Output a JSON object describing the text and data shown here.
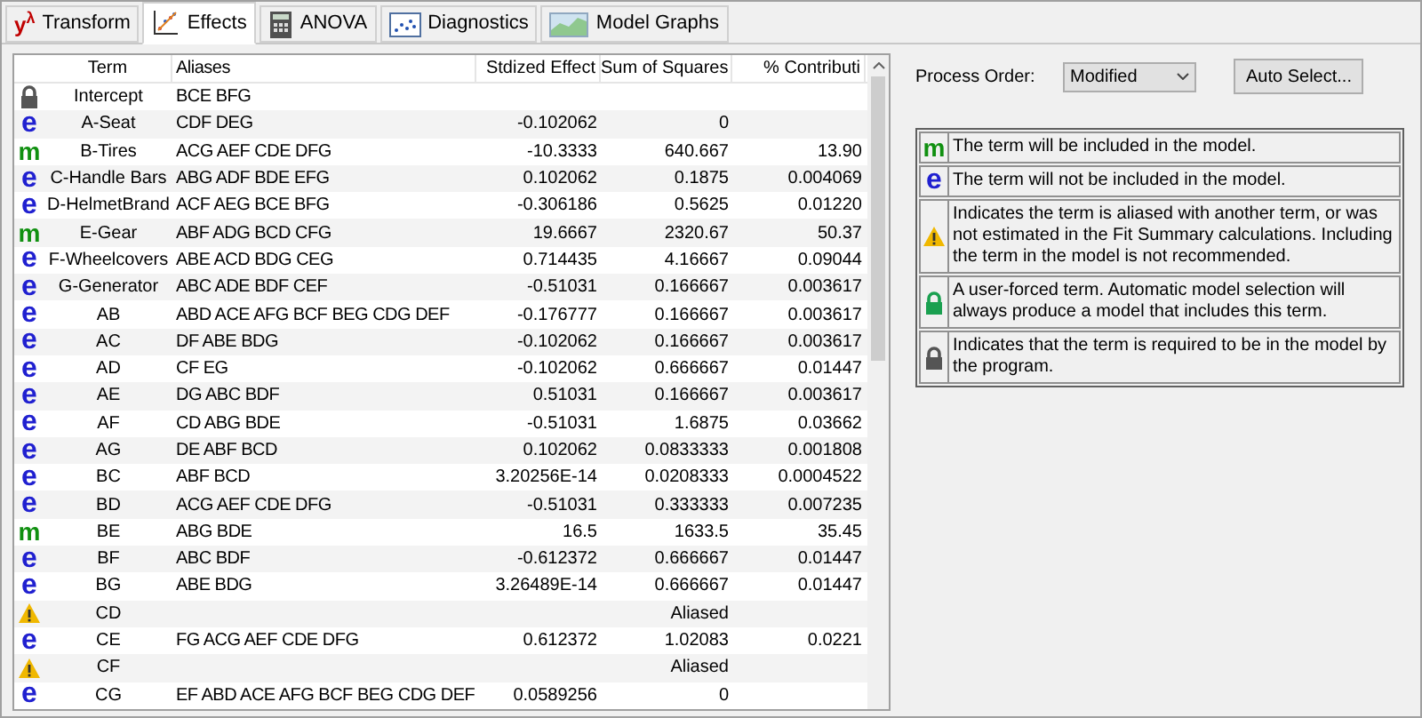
{
  "tabs": [
    {
      "label": "Transform",
      "symbol": "y$^{λ}$",
      "selected": false
    },
    {
      "label": "Effects",
      "selected": true
    },
    {
      "label": "ANOVA",
      "selected": false
    },
    {
      "label": "Diagnostics",
      "selected": false
    },
    {
      "label": "Model Graphs",
      "selected": false
    }
  ],
  "table": {
    "columns": [
      "Term",
      "Aliases",
      "Stdized Effect",
      "Sum of Squares",
      "% Contributi"
    ],
    "rows": [
      {
        "kind": "required",
        "term": "Intercept",
        "aliases": "BCE BFG",
        "effect": "",
        "ss": "",
        "contribution": ""
      },
      {
        "kind": "excluded",
        "symbol": "e",
        "term": "A-Seat",
        "aliases": "CDF DEG",
        "effect": "-0.102062",
        "ss": "0",
        "contribution": ""
      },
      {
        "kind": "included",
        "symbol": "m",
        "term": "B-Tires",
        "aliases": "ACG AEF CDE DFG",
        "effect": "-10.3333",
        "ss": "640.667",
        "contribution": "13.90"
      },
      {
        "kind": "excluded",
        "symbol": "e",
        "term": "C-Handle Bars",
        "aliases": "ABG ADF BDE EFG",
        "effect": "0.102062",
        "ss": "0.1875",
        "contribution": "0.004069"
      },
      {
        "kind": "excluded",
        "symbol": "e",
        "term": "D-HelmetBrand",
        "aliases": "ACF AEG BCE BFG",
        "effect": "-0.306186",
        "ss": "0.5625",
        "contribution": "0.01220"
      },
      {
        "kind": "included",
        "symbol": "m",
        "term": "E-Gear",
        "aliases": "ABF ADG BCD CFG",
        "effect": "19.6667",
        "ss": "2320.67",
        "contribution": "50.37"
      },
      {
        "kind": "excluded",
        "symbol": "e",
        "term": "F-Wheelcovers",
        "aliases": "ABE ACD BDG CEG",
        "effect": "0.714435",
        "ss": "4.16667",
        "contribution": "0.09044"
      },
      {
        "kind": "excluded",
        "symbol": "e",
        "term": "G-Generator",
        "aliases": "ABC ADE BDF CEF",
        "effect": "-0.51031",
        "ss": "0.166667",
        "contribution": "0.003617"
      },
      {
        "kind": "excluded",
        "symbol": "e",
        "term": "AB",
        "aliases": "ABD ACE AFG BCF BEG CDG DEF",
        "effect": "-0.176777",
        "ss": "0.166667",
        "contribution": "0.003617"
      },
      {
        "kind": "excluded",
        "symbol": "e",
        "term": "AC",
        "aliases": "DF ABE BDG",
        "effect": "-0.102062",
        "ss": "0.166667",
        "contribution": "0.003617"
      },
      {
        "kind": "excluded",
        "symbol": "e",
        "term": "AD",
        "aliases": "CF EG",
        "effect": "-0.102062",
        "ss": "0.666667",
        "contribution": "0.01447"
      },
      {
        "kind": "excluded",
        "symbol": "e",
        "term": "AE",
        "aliases": "DG ABC BDF",
        "effect": "0.51031",
        "ss": "0.166667",
        "contribution": "0.003617"
      },
      {
        "kind": "excluded",
        "symbol": "e",
        "term": "AF",
        "aliases": "CD ABG BDE",
        "effect": "-0.51031",
        "ss": "1.6875",
        "contribution": "0.03662"
      },
      {
        "kind": "excluded",
        "symbol": "e",
        "term": "AG",
        "aliases": "DE ABF BCD",
        "effect": "0.102062",
        "ss": "0.0833333",
        "contribution": "0.001808"
      },
      {
        "kind": "excluded",
        "symbol": "e",
        "term": "BC",
        "aliases": "ABF BCD",
        "effect": "3.20256E-14",
        "ss": "0.0208333",
        "contribution": "0.0004522"
      },
      {
        "kind": "excluded",
        "symbol": "e",
        "term": "BD",
        "aliases": "ACG AEF CDE DFG",
        "effect": "-0.51031",
        "ss": "0.333333",
        "contribution": "0.007235"
      },
      {
        "kind": "included",
        "symbol": "m",
        "term": "BE",
        "aliases": "ABG BDE",
        "effect": "16.5",
        "ss": "1633.5",
        "contribution": "35.45"
      },
      {
        "kind": "excluded",
        "symbol": "e",
        "term": "BF",
        "aliases": "ABC BDF",
        "effect": "-0.612372",
        "ss": "0.666667",
        "contribution": "0.01447"
      },
      {
        "kind": "excluded",
        "symbol": "e",
        "term": "BG",
        "aliases": "ABE BDG",
        "effect": "3.26489E-14",
        "ss": "0.666667",
        "contribution": "0.01447"
      },
      {
        "kind": "aliased",
        "term": "CD",
        "aliases": "",
        "effect": "",
        "ss": "Aliased",
        "contribution": ""
      },
      {
        "kind": "excluded",
        "symbol": "e",
        "term": "CE",
        "aliases": "FG ACG AEF CDE DFG",
        "effect": "0.612372",
        "ss": "1.02083",
        "contribution": "0.0221"
      },
      {
        "kind": "aliased",
        "term": "CF",
        "aliases": "",
        "effect": "",
        "ss": "Aliased",
        "contribution": ""
      },
      {
        "kind": "excluded",
        "symbol": "e",
        "term": "CG",
        "aliases": "EF ABD ACE AFG BCF BEG CDG DEF",
        "effect": "0.0589256",
        "ss": "0",
        "contribution": ""
      }
    ]
  },
  "process_order": {
    "label": "Process Order:",
    "value": "Modified"
  },
  "auto_select_button": "Auto Select...",
  "legend": [
    {
      "kind": "included",
      "symbol": "m",
      "text": "The term will be included in the model."
    },
    {
      "kind": "excluded",
      "symbol": "e",
      "text": "The term will not be included in the model."
    },
    {
      "kind": "aliased",
      "text": "Indicates the term is aliased with another term, or was not estimated in the Fit Summary calculations. Including the term in the model is not recommended."
    },
    {
      "kind": "forced",
      "text": "A user-forced term. Automatic model selection will always produce a model that includes this term."
    },
    {
      "kind": "required",
      "text": "Indicates that the term is required to be in the model by the program."
    }
  ]
}
